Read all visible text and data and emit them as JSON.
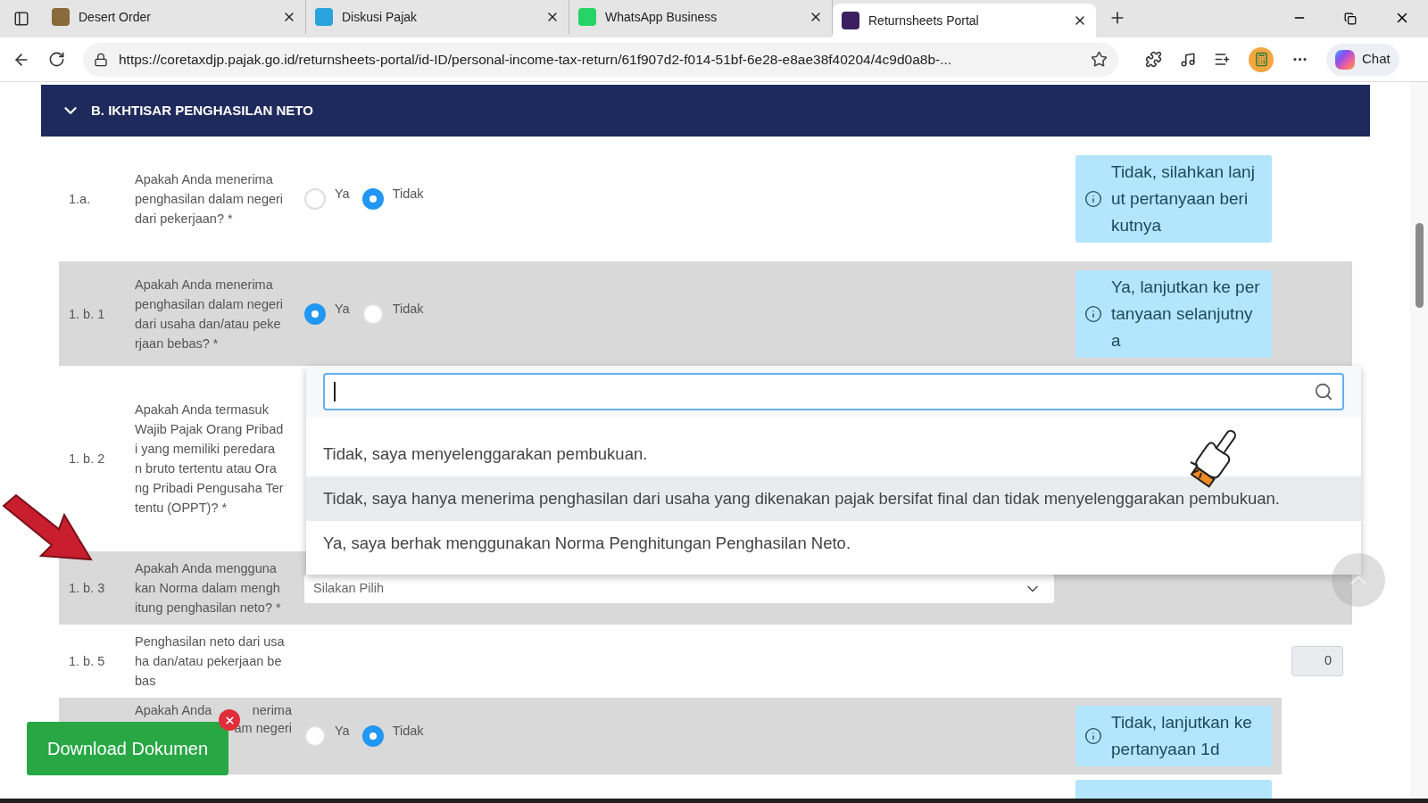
{
  "browser": {
    "tabs": [
      {
        "title": "Desert Order",
        "selected": false
      },
      {
        "title": "Diskusi Pajak",
        "selected": false
      },
      {
        "title": "WhatsApp Business",
        "selected": false
      },
      {
        "title": "Returnsheets Portal",
        "selected": true
      }
    ],
    "url": "https://coretaxdjp.pajak.go.id/returnsheets-portal/id-ID/personal-income-tax-return/61f907d2-f014-51bf-6e28-e8ae38f40204/4c9d0a8b-...",
    "chat_label": "Chat"
  },
  "section": {
    "title": "B. IKHTISAR PENGHASILAN NETO",
    "expanded": true
  },
  "rows": [
    {
      "number": "1.a.",
      "shaded": false,
      "kind": "radio",
      "question_lines": [
        "Apakah Anda menerima",
        "penghasilan dalam negeri",
        "dari pekerjaan? *"
      ],
      "options": [
        {
          "label": "Ya",
          "selected": false
        },
        {
          "label": "Tidak",
          "selected": true
        }
      ],
      "info": [
        "Tidak, silahkan lanj",
        "ut pertanyaan beri",
        "kutnya"
      ]
    },
    {
      "number": "1. b. 1",
      "shaded": true,
      "kind": "radio",
      "question_lines": [
        "Apakah Anda menerima",
        "penghasilan dalam negeri",
        "dari usaha dan/atau peke",
        "rjaan bebas? *"
      ],
      "options": [
        {
          "label": "Ya",
          "selected": true
        },
        {
          "label": "Tidak",
          "selected": false
        }
      ],
      "info": [
        "Ya, lanjutkan ke per",
        "tanyaan selanjutny",
        "a"
      ]
    },
    {
      "number": "1. b. 2",
      "shaded": false,
      "kind": "blank",
      "question_lines": [
        "Apakah Anda termasuk",
        "Wajib Pajak Orang Pribad",
        "i yang memiliki peredara",
        "n bruto tertentu atau Ora",
        "ng Pribadi Pengusaha Ter",
        "tentu (OPPT)? *"
      ]
    },
    {
      "number": "1. b. 3",
      "shaded": true,
      "kind": "select",
      "question_lines": [
        "Apakah Anda mengguna",
        "kan Norma dalam mengh",
        "itung penghasilan neto? *"
      ],
      "placeholder": "Silakan Pilih",
      "open": true,
      "dropdown_options": [
        {
          "label": "Tidak, saya menyelenggarakan pembukuan.",
          "highlighted": false
        },
        {
          "label": "Tidak, saya hanya menerima penghasilan dari usaha yang dikenakan pajak bersifat final dan tidak menyelenggarakan pembukuan.",
          "highlighted": true
        },
        {
          "label": "Ya, saya berhak menggunakan Norma Penghitungan Penghasilan Neto.",
          "highlighted": false
        }
      ]
    },
    {
      "number": "1. b. 5",
      "shaded": false,
      "kind": "number",
      "question_lines": [
        "Penghasilan neto dari usa",
        "ha dan/atau pekerjaan be",
        "bas"
      ],
      "value": "0"
    },
    {
      "shaded": true,
      "kind": "radio",
      "question_fragments": [
        [
          "Apakah Anda",
          "nerima"
        ],
        [
          "am negeri"
        ]
      ],
      "options": [
        {
          "label": "Ya",
          "selected": false
        },
        {
          "label": "Tidak",
          "selected": true
        }
      ],
      "info": [
        "Tidak, lanjutkan ke",
        "pertanyaan 1d"
      ]
    }
  ],
  "download": {
    "label": "Download Dokumen"
  }
}
